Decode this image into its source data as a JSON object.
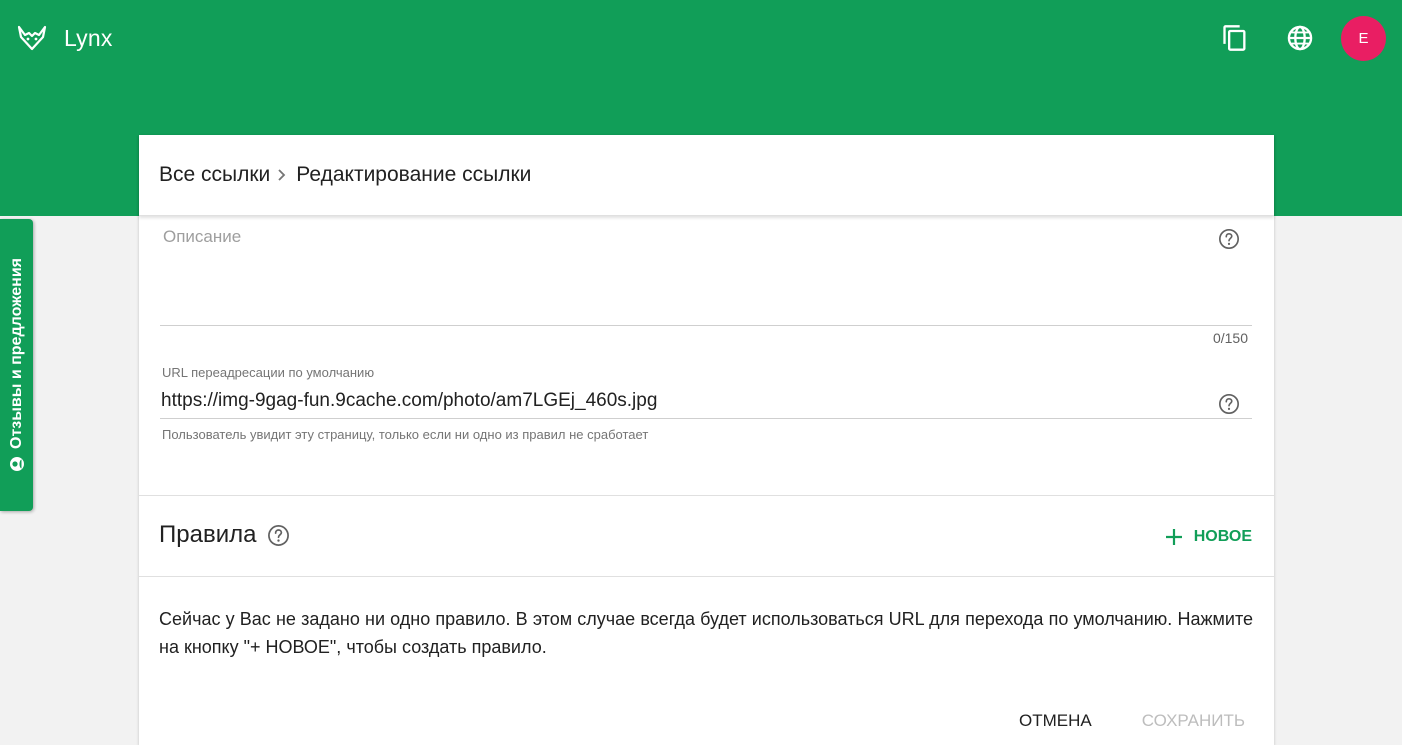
{
  "app": {
    "name": "Lynx"
  },
  "header": {
    "icons": [
      "copy-icon",
      "globe-icon"
    ],
    "avatar_letter": "E"
  },
  "feedback": {
    "label": "Отзывы и предложения"
  },
  "breadcrumb": {
    "root": "Все ссылки",
    "current": "Редактирование ссылки"
  },
  "description": {
    "placeholder": "Описание",
    "value": "",
    "counter": "0/150"
  },
  "redirect": {
    "label": "URL переадресации по умолчанию",
    "value": "https://img-9gag-fun.9cache.com/photo/am7LGEj_460s.jpg",
    "hint": "Пользователь увидит эту страницу, только если ни одно из правил не сработает"
  },
  "rules": {
    "title": "Правила",
    "new_label": "НОВОЕ",
    "empty_text": "Сейчас у Вас не задано ни одно правило. В этом случае всегда будет использоваться URL для перехода по умолчанию. Нажмите на кнопку \"+ НОВОЕ\", чтобы создать правило."
  },
  "actions": {
    "cancel": "ОТМЕНА",
    "save": "СОХРАНИТЬ"
  },
  "colors": {
    "primary": "#119e58",
    "avatar": "#e91e63",
    "disabled": "#bdbdbd"
  }
}
